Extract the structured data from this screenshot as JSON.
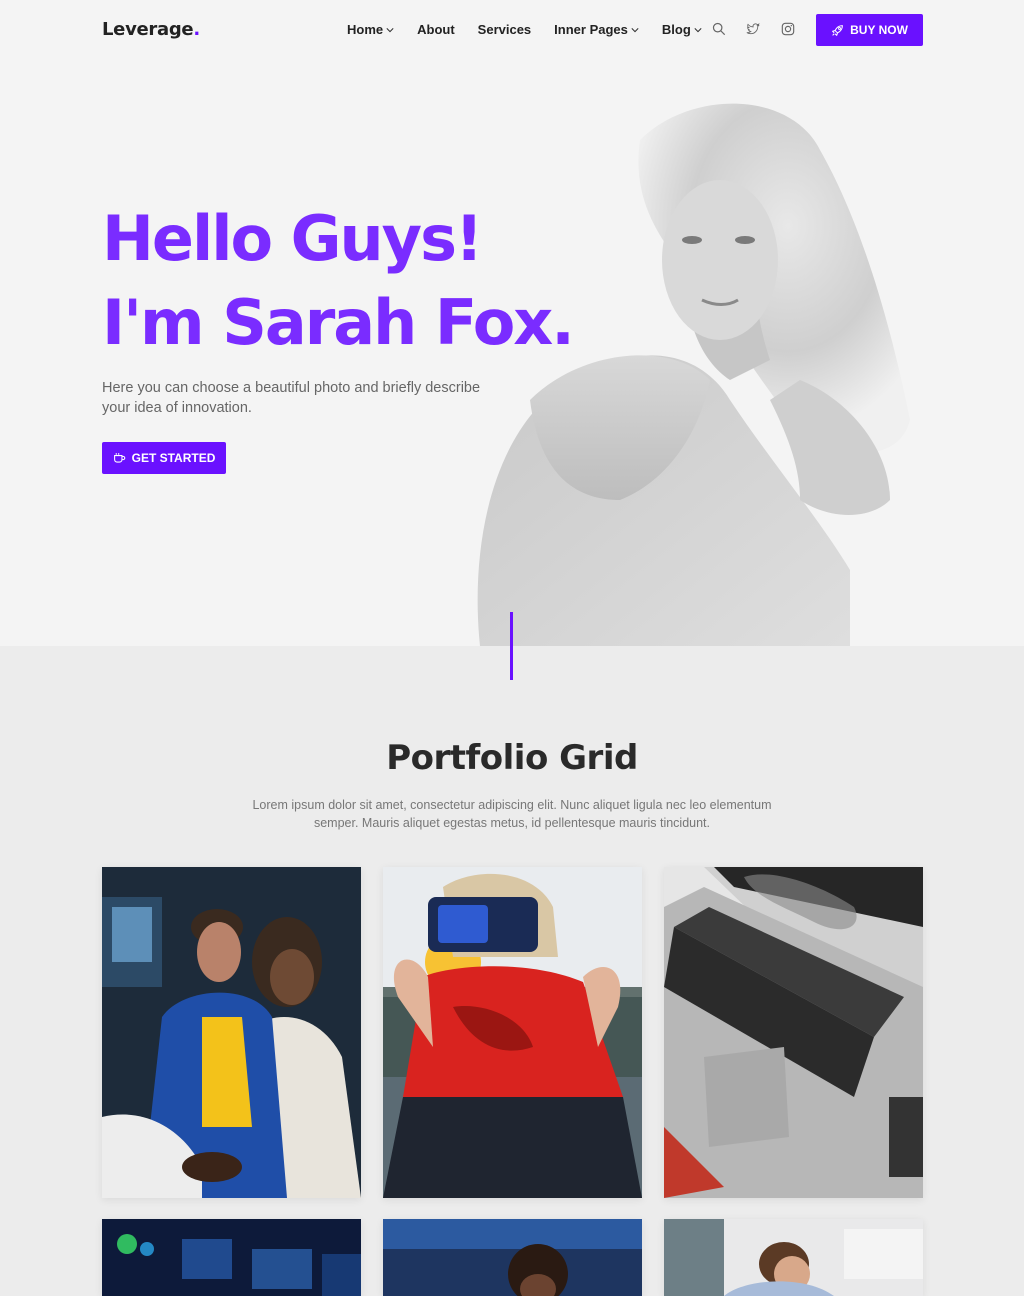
{
  "nav": {
    "logo": "Leverage",
    "logo_dot": ".",
    "items": [
      {
        "label": "Home",
        "dropdown": true
      },
      {
        "label": "About",
        "dropdown": false
      },
      {
        "label": "Services",
        "dropdown": false
      },
      {
        "label": "Inner Pages",
        "dropdown": true
      },
      {
        "label": "Blog",
        "dropdown": true
      }
    ],
    "icons": [
      "search-icon",
      "twitter-icon",
      "instagram-icon"
    ],
    "buy_label": "BUY NOW"
  },
  "hero": {
    "line1": "Hello Guys!",
    "line2": "I'm Sarah Fox.",
    "lead": "Here you can choose a beautiful photo and briefly describe your idea of innovation.",
    "cta_label": "GET STARTED"
  },
  "portfolio": {
    "title": "Portfolio Grid",
    "description": "Lorem ipsum dolor sit amet, consectetur adipiscing elit. Nunc aliquet ligula nec leo elementum semper. Mauris aliquet egestas metus, id pellentesque mauris tincidunt."
  },
  "colors": {
    "accent": "#6a11ff",
    "heading_gradient_start": "#6a11ff",
    "heading_gradient_end": "#8a3cff",
    "background": "#f4f4f4"
  }
}
